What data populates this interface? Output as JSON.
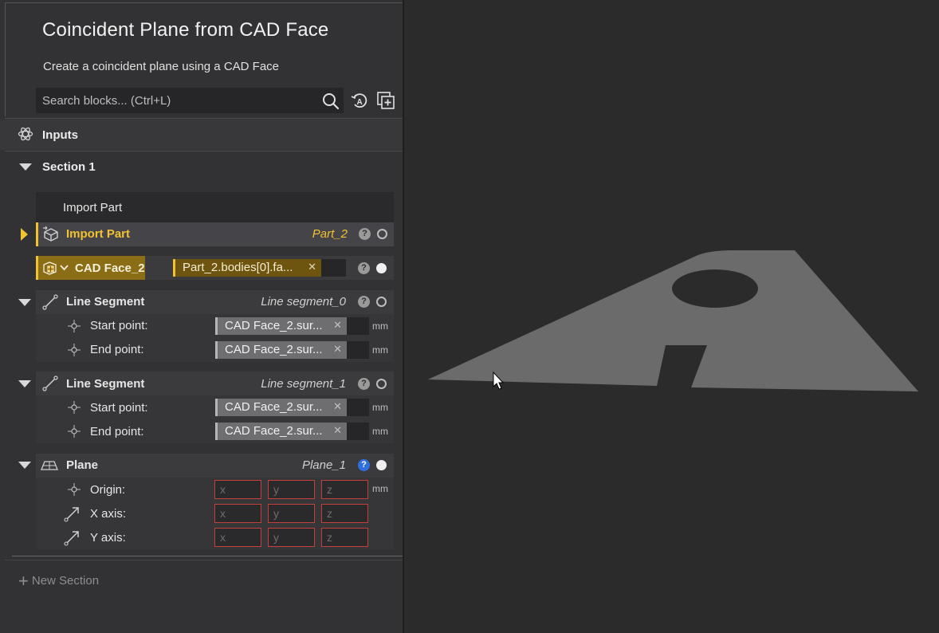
{
  "header": {
    "title": "Coincident Plane from CAD Face",
    "subtitle": "Create a coincident plane using a CAD Face"
  },
  "search": {
    "placeholder": "Search blocks... (Ctrl+L)"
  },
  "icons": {
    "search": "search-icon",
    "auto": "auto-layout-icon",
    "add_block": "add-block-icon"
  },
  "inputs_section": {
    "label": "Inputs"
  },
  "section1": {
    "label": "Section 1",
    "group_title": "Import Part",
    "import_part": {
      "label": "Import Part",
      "value": "Part_2"
    },
    "cad_face": {
      "label": "CAD Face_2",
      "value": "Part_2.bodies[0].fa..."
    },
    "line_segment_0": {
      "label": "Line Segment",
      "name": "Line segment_0",
      "start_label": "Start point:",
      "start_value": "CAD Face_2.sur...",
      "end_label": "End point:",
      "end_value": "CAD Face_2.sur...",
      "unit": "mm"
    },
    "line_segment_1": {
      "label": "Line Segment",
      "name": "Line segment_1",
      "start_label": "Start point:",
      "start_value": "CAD Face_2.sur...",
      "end_label": "End point:",
      "end_value": "CAD Face_2.sur...",
      "unit": "mm"
    },
    "plane": {
      "label": "Plane",
      "name": "Plane_1",
      "origin_label": "Origin:",
      "x_axis_label": "X axis:",
      "y_axis_label": "Y axis:",
      "placeholder_x": "x",
      "placeholder_y": "y",
      "placeholder_z": "z",
      "unit": "mm"
    }
  },
  "new_section": {
    "label": "New Section"
  },
  "colors": {
    "accent": "#f2c230",
    "error": "#c4403a",
    "help_blue": "#2f6fe0",
    "part_gray": "#6b6b6b"
  }
}
